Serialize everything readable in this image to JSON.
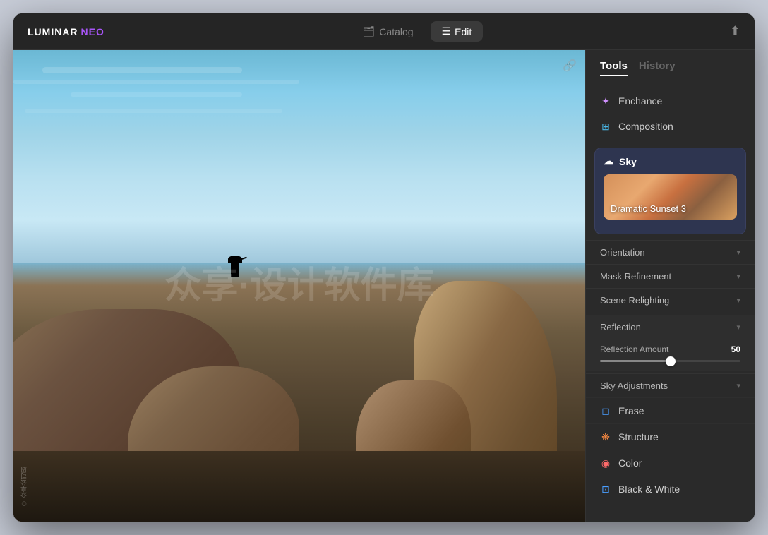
{
  "app": {
    "logo_main": "LUMINAR",
    "logo_accent": "NEO"
  },
  "titlebar": {
    "catalog_label": "Catalog",
    "edit_label": "Edit",
    "share_icon": "⬆"
  },
  "canvas": {
    "icon": "🔗"
  },
  "sidebar": {
    "tabs": [
      {
        "id": "tools",
        "label": "Tools",
        "active": true
      },
      {
        "id": "history",
        "label": "History",
        "active": false
      }
    ],
    "items": [
      {
        "id": "enchance",
        "label": "Enchance",
        "icon": "✦",
        "icon_color": "#d090ff"
      },
      {
        "id": "composition",
        "label": "Composition",
        "icon": "⊞",
        "icon_color": "#4ab8e8"
      }
    ],
    "sky_panel": {
      "icon": "☁",
      "label": "Sky",
      "preset_label": "Dramatic Sunset 3"
    },
    "collapsible": [
      {
        "id": "orientation",
        "label": "Orientation"
      },
      {
        "id": "mask-refinement",
        "label": "Mask Refinement"
      },
      {
        "id": "scene-relighting",
        "label": "Scene Relighting"
      }
    ],
    "reflection": {
      "label": "Reflection",
      "amount_label": "Reflection Amount",
      "amount_value": "50",
      "amount_percent": 50
    },
    "sky_adjustments": {
      "label": "Sky Adjustments"
    },
    "tools": [
      {
        "id": "erase",
        "label": "Erase",
        "icon": "◻",
        "icon_color": "#4a9eff"
      },
      {
        "id": "structure",
        "label": "Structure",
        "icon": "❋",
        "icon_color": "#ff8c42"
      },
      {
        "id": "color",
        "label": "Color",
        "icon": "◉",
        "icon_color": "#ff6b6b"
      },
      {
        "id": "black-white",
        "label": "Black & White",
        "icon": "⊡",
        "icon_color": "#4a9eff"
      }
    ]
  },
  "watermark": {
    "line1": "众享·设计软件库",
    "line2": ""
  }
}
